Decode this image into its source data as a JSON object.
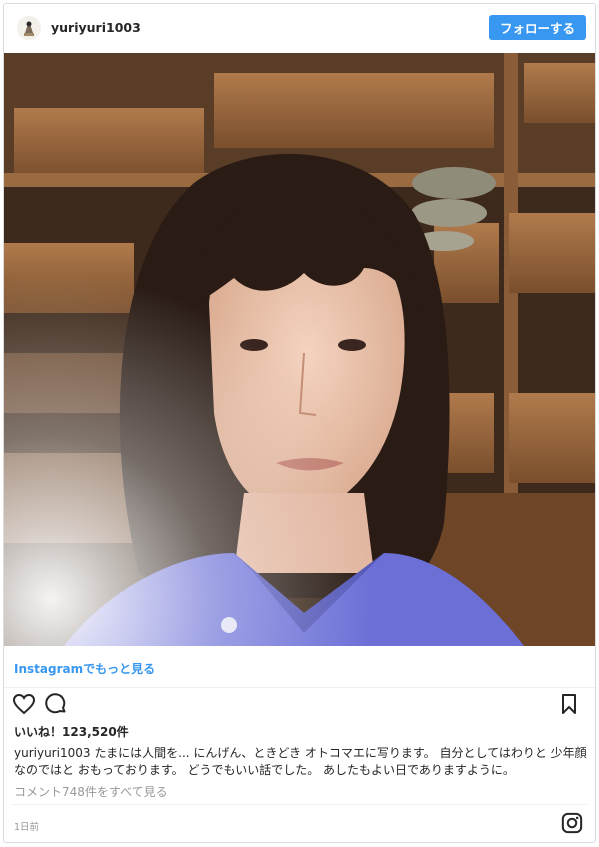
{
  "header": {
    "username": "yuriyuri1003",
    "follow_label": "フォローする"
  },
  "photo": {
    "alt": ""
  },
  "more_link": "Instagramでもっと見る",
  "likes": {
    "label": "いいね！",
    "count": "123,520件"
  },
  "caption": {
    "username": "yuriyuri1003",
    "text": "たまには人間を... にんげん、ときどき オトコマエに写ります。 自分としてはわりと 少年顔なのではと おもっております。 どうでもいい話でした。 あしたもよい日でありますように。"
  },
  "comments_link": "コメント748件をすべて見る",
  "timestamp": "1日前",
  "colors": {
    "accent": "#3897f0",
    "muted": "#999999",
    "text": "#262626"
  },
  "icons": [
    "heart-icon",
    "comment-icon",
    "bookmark-icon",
    "instagram-icon"
  ]
}
